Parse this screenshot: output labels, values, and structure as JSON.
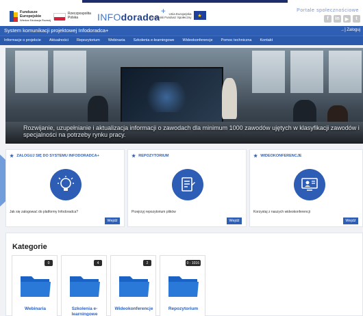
{
  "top_logos": {
    "fe_line1": "Fundusze",
    "fe_line2": "Europejskie",
    "fe_line3": "Wiedza Edukacja Rozwój",
    "pl_line1": "Rzeczpospolita",
    "pl_line2": "Polska",
    "brand_light": "INFO",
    "brand_bold": "doradca",
    "brand_plus": "+",
    "ue_line1": "Unia Europejska",
    "ue_line2": "Europejski Fundusz Społeczny",
    "portal_label": "Portale społecznościowe",
    "social_icons": [
      "facebook-icon",
      "linkedin-icon",
      "youtube-icon",
      "twitter-icon"
    ]
  },
  "header": {
    "title": "System komunikacji projektowej Infodoradca+",
    "login": "→] Zaloguj"
  },
  "nav": {
    "items": [
      "Informacje o projekcie",
      "Aktualności",
      "Repozytorium",
      "Webinaria",
      "Szkolenia e-learningowe",
      "Wideokonferencje",
      "Pomoc techniczna",
      "Kontakt"
    ]
  },
  "hero": {
    "caption": "Rozwijanie, uzupełnianie i aktualizacja informacji o zawodach dla minimum 1000 zawodów ujętych w klasyfikacji zawodów i specjalności na potrzeby rynku pracy."
  },
  "cards": [
    {
      "title": "ZALOGUJ SIĘ DO SYSTEMU INFODORADCA+",
      "desc": "Jak się zalogować do platformy Infodoradca?",
      "button": "Wejdź",
      "icon": "lightbulb-icon"
    },
    {
      "title": "REPOZYTORIUM",
      "desc": "Przejrzyj repozytorium plików",
      "button": "Wejdź",
      "icon": "document-icon"
    },
    {
      "title": "WIDEOKONFERENCJE",
      "desc": "Korzystaj z naszych wideokonferencji",
      "button": "Wejdź",
      "icon": "video-conference-icon"
    }
  ],
  "categories": {
    "heading": "Kategorie",
    "items": [
      {
        "label": "Webinaria",
        "count": "0"
      },
      {
        "label": "Szkolenia e-learningowe",
        "count": "4"
      },
      {
        "label": "Wideokonferencje",
        "count": "2"
      },
      {
        "label": "Repozytorium",
        "count": "0 - 1016"
      }
    ]
  },
  "colors": {
    "primary": "#2f5fb5",
    "nav": "#2b59ab",
    "page_bg": "#f1f2f6"
  }
}
